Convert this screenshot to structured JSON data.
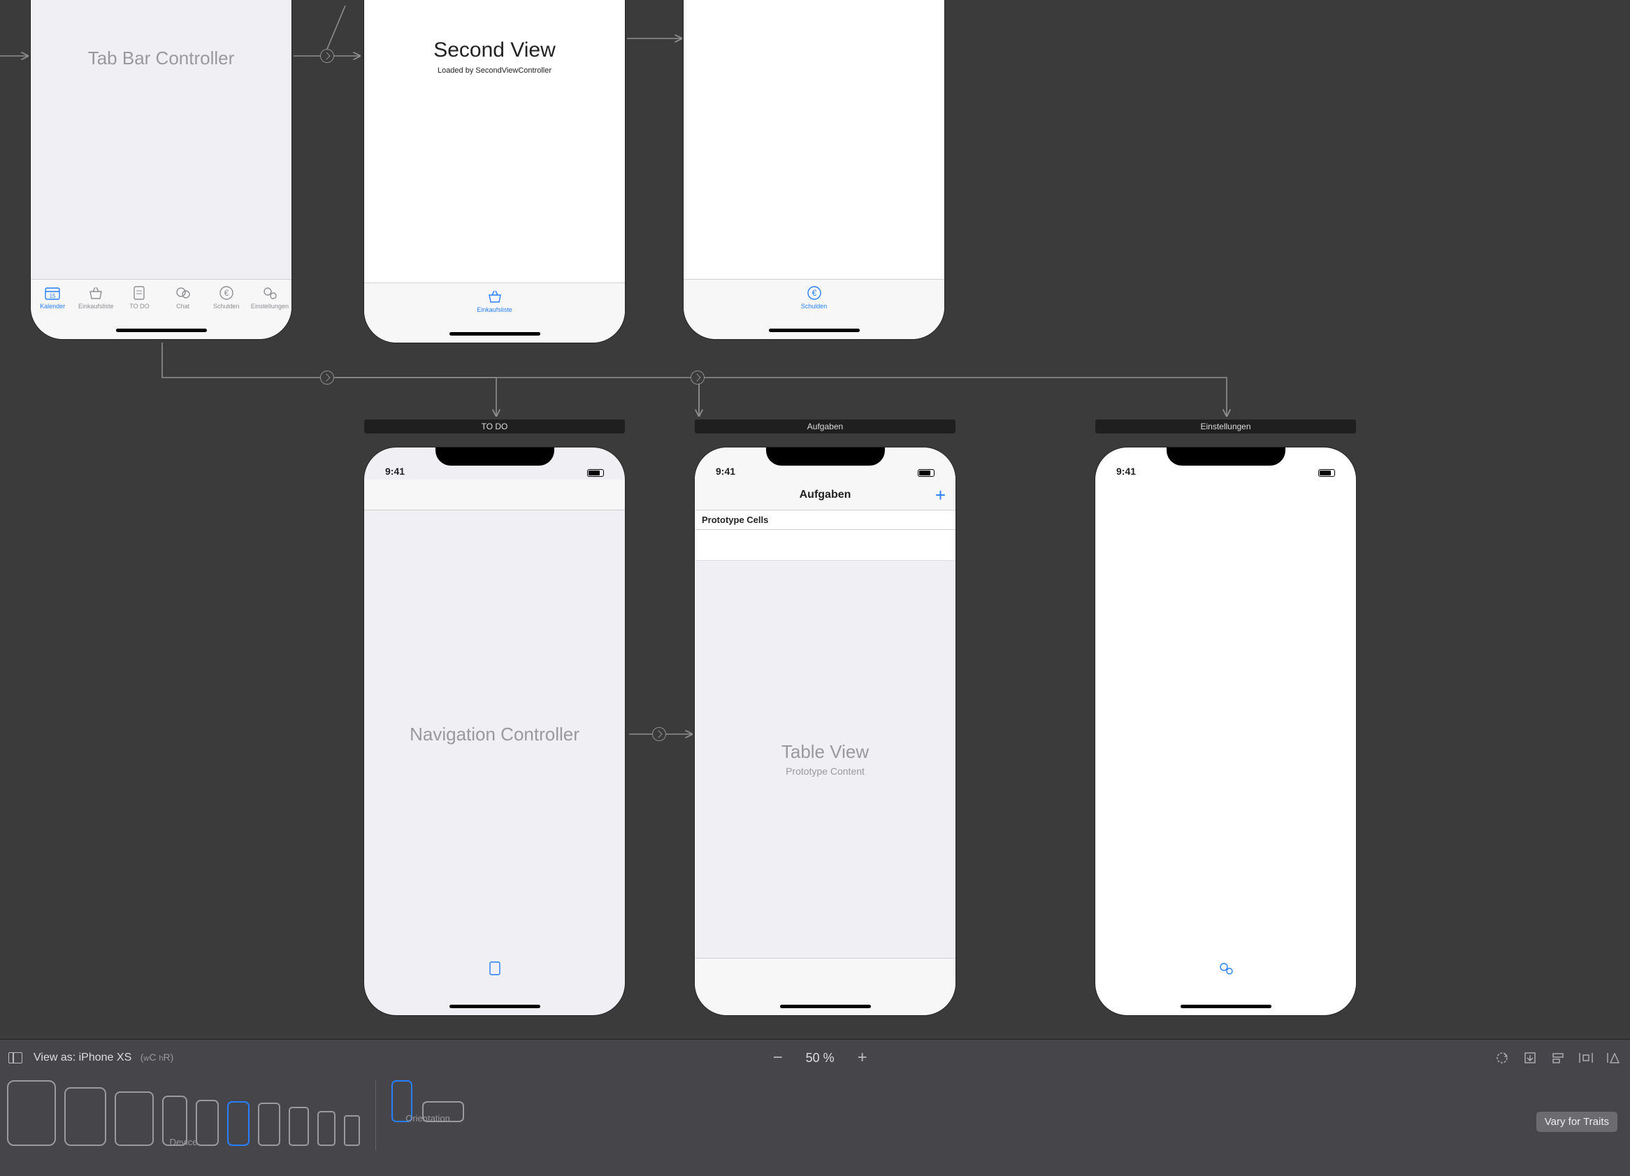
{
  "canvas": {
    "tabBarController": {
      "title": "Tab Bar Controller",
      "tabs": [
        {
          "label": "Kalender",
          "active": true
        },
        {
          "label": "Einkaufsliste",
          "active": false
        },
        {
          "label": "TO DO",
          "active": false
        },
        {
          "label": "Chat",
          "active": false
        },
        {
          "label": "Schulden",
          "active": false
        },
        {
          "label": "Einstellungen",
          "active": false
        }
      ]
    },
    "secondView": {
      "title": "Second View",
      "subtitle": "Loaded by SecondViewController",
      "tab": {
        "label": "Einkaufsliste"
      }
    },
    "thirdView": {
      "tab": {
        "label": "Schulden"
      }
    },
    "navController": {
      "header": "TO DO",
      "time": "9:41",
      "placeholder": "Navigation Controller"
    },
    "aufgaben": {
      "header": "Aufgaben",
      "time": "9:41",
      "navTitle": "Aufgaben",
      "plus": "+",
      "protoHeader": "Prototype Cells",
      "tvTitle": "Table View",
      "tvSub": "Prototype Content"
    },
    "einstellungen": {
      "header": "Einstellungen",
      "time": "9:41"
    }
  },
  "bottom": {
    "viewAsPrefix": "View as: ",
    "viewAsDevice": "iPhone XS",
    "sizeClass": {
      "w": "w",
      "wv": "C",
      "h": "h",
      "hv": "R"
    },
    "zoom": "50 %",
    "deviceLabel": "Device",
    "orientLabel": "Orientation",
    "varyTraits": "Vary for Traits"
  }
}
